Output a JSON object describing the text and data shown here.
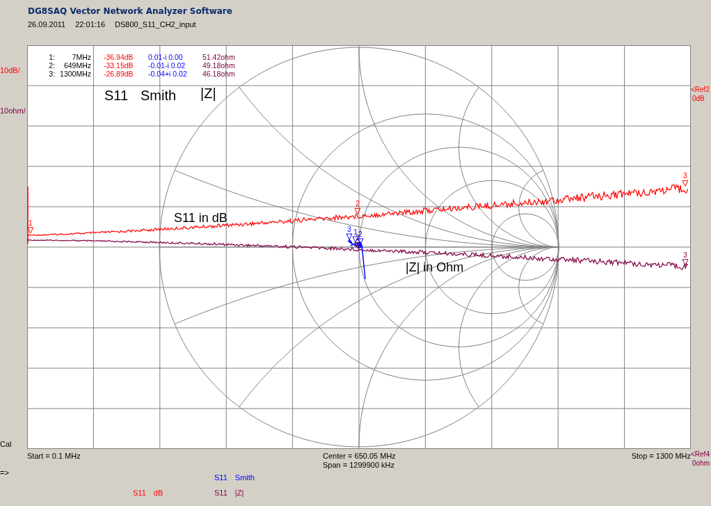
{
  "app": {
    "title": "DG8SAQ Vector Network Analyzer Software",
    "date": "26.09.2011",
    "time": "22:01:16",
    "file": "DS800_S11_CH2_input"
  },
  "scales": [
    {
      "text": "10dB/",
      "color": "#ff0000"
    },
    {
      "text": "10ohm/",
      "color": "#800040"
    }
  ],
  "cal": "Cal",
  "refs": [
    {
      "text": "<Ref2",
      "value": "0dB",
      "color": "#ff0000"
    },
    {
      "text": "<Ref4",
      "value": "0ohm",
      "color": "#800040"
    }
  ],
  "marker_table": [
    {
      "index": "1:",
      "freq": "7MHz",
      "db": "-36.94dB",
      "smith": "0.01-i 0.00",
      "z": "51.42ohm"
    },
    {
      "index": "2:",
      "freq": "649MHz",
      "db": "-33.15dB",
      "smith": "-0.01-i 0.02",
      "z": "49.18ohm"
    },
    {
      "index": "3:",
      "freq": "1300MHz",
      "db": "-26.89dB",
      "smith": "-0.04+i 0.02",
      "z": "46.18ohm"
    }
  ],
  "plot_labels": [
    "S11",
    "Smith",
    "|Z|",
    "S11 in dB",
    "|Z| in Ohm"
  ],
  "traces": [
    {
      "legend": "S11 dB",
      "color": "#ff0000",
      "markers": [
        "1",
        "2",
        "3"
      ]
    },
    {
      "legend": "S11 Smith",
      "color": "#0000ff",
      "markers": [
        "1",
        "2",
        "3"
      ]
    },
    {
      "legend": "S11 |Z|",
      "color": "#800040",
      "markers": [
        "2",
        "3"
      ]
    }
  ],
  "sweep": {
    "start": "Start = 0.1 MHz",
    "center": "Center = 650.05 MHz",
    "span": "Span = 1299900 kHz",
    "stop": "Stop = 1300 MHz"
  },
  "prompt": "=>"
}
